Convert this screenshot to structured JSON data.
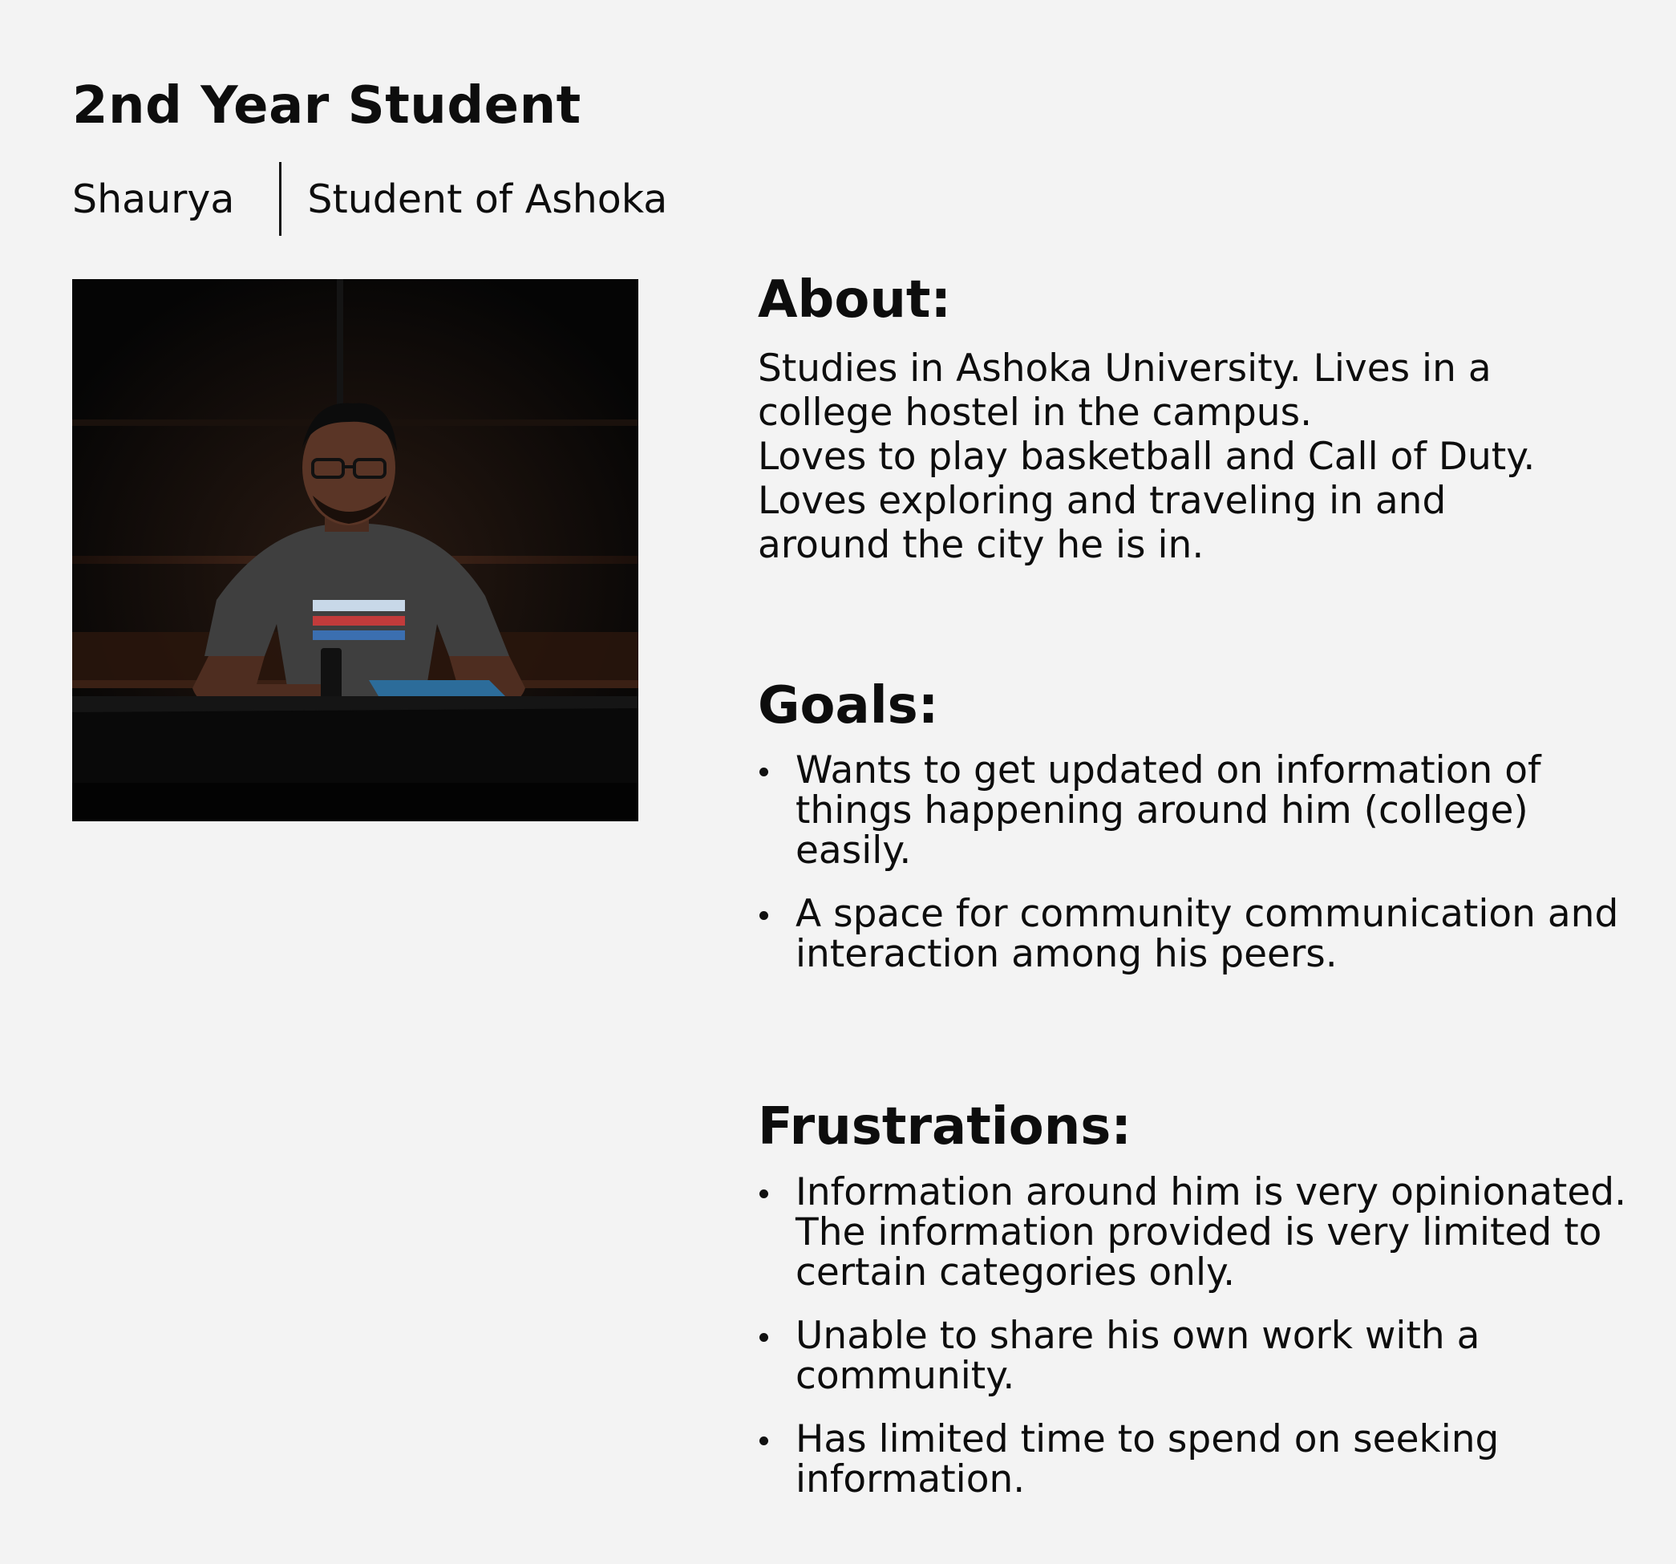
{
  "header": {
    "title": "2nd Year Student",
    "name": "Shaurya",
    "role": "Student of Ashoka"
  },
  "about": {
    "heading": "About:",
    "lines": [
      "Studies in Ashoka University. Lives in a",
      "college hostel in the campus.",
      "Loves to play basketball and Call of Duty.",
      "Loves exploring and traveling in and",
      "around the city he is in."
    ]
  },
  "goals": {
    "heading": "Goals:",
    "items": [
      "Wants to get updated on information of things happening around him (college) easily.",
      "A space for community communication and interaction among his peers."
    ]
  },
  "frustrations": {
    "heading": "Frustrations:",
    "items": [
      "Information around him is very opinionated. The information provided is very limited to certain categories only.",
      "Unable to share his own work with a community.",
      "Has limited time to spend on seeking information."
    ]
  }
}
